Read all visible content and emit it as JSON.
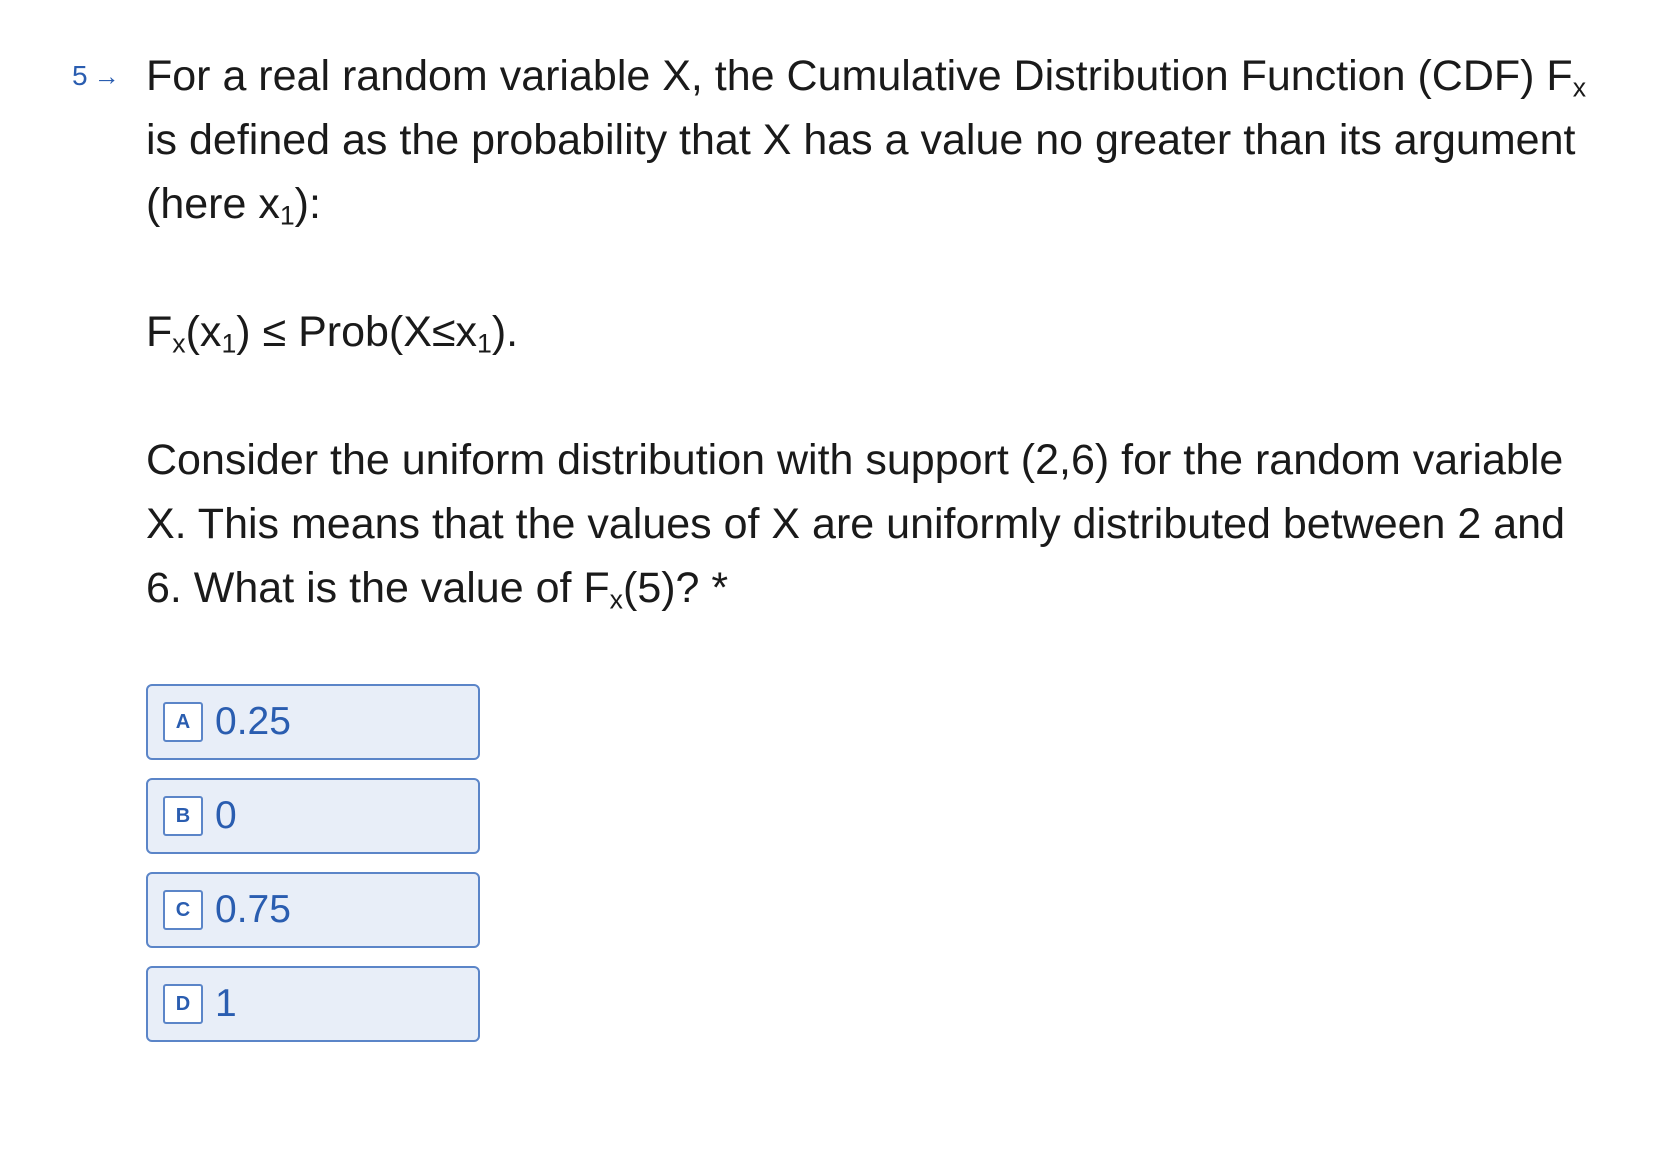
{
  "question": {
    "number": "5",
    "intro_pre": "For a real random variable X, the Cumulative Distribution Function (CDF) F",
    "intro_sub": "x",
    "intro_mid": " is defined as the probability that X has a value no greater than its argument (here x",
    "intro_sub2": "1",
    "intro_post": "):",
    "formula_f": "F",
    "formula_sub_x": "x",
    "formula_open": "(x",
    "formula_sub_1a": "1",
    "formula_mid": ") ≤ Prob(X≤x",
    "formula_sub_1b": "1",
    "formula_end": ").",
    "body_pre": "Consider the uniform distribution with support (2,6) for the random variable X. This means that the values of X are uniformly distributed between 2 and 6. What is the value of F",
    "body_sub": "x",
    "body_post": "(5)? *"
  },
  "choices": [
    {
      "key": "A",
      "label": "0.25"
    },
    {
      "key": "B",
      "label": "0"
    },
    {
      "key": "C",
      "label": "0.75"
    },
    {
      "key": "D",
      "label": "1"
    }
  ],
  "colors": {
    "accent": "#2a5db0",
    "choice_bg": "#e8eef8",
    "choice_border": "#5b85c8",
    "text": "#1a1a1a"
  },
  "icons": {
    "number_arrow": "arrow-right-icon"
  }
}
